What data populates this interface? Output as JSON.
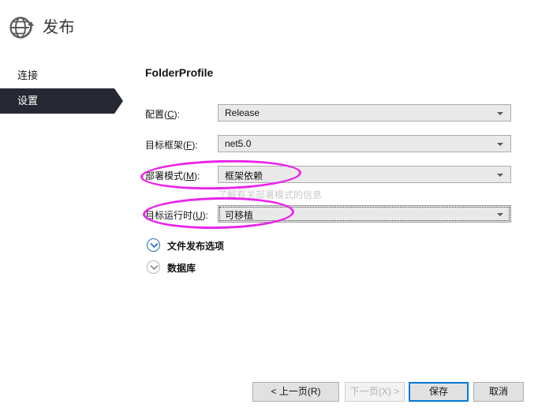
{
  "window": {
    "title": "发布",
    "icon": "globe-publish-icon"
  },
  "sidebar": {
    "items": [
      {
        "label": "连接",
        "selected": false
      },
      {
        "label": "设置",
        "selected": true
      }
    ]
  },
  "main": {
    "profile_title": "FolderProfile",
    "fields": [
      {
        "label_prefix": "配置(",
        "accel": "C",
        "label_suffix": "):",
        "value": "Release",
        "focused": false
      },
      {
        "label_prefix": "目标框架(",
        "accel": "F",
        "label_suffix": "):",
        "value": "net5.0",
        "focused": false
      },
      {
        "label_prefix": "部署模式(",
        "accel": "M",
        "label_suffix": "):",
        "value": "框架依赖",
        "focused": false
      },
      {
        "label_prefix": "目标运行时(",
        "accel": "U",
        "label_suffix": "):",
        "value": "可移植",
        "focused": true
      }
    ],
    "help_link": "了解有关部署模式的信息",
    "expanders": [
      {
        "label": "文件发布选项",
        "chevron": "chevron-down-icon",
        "state": "collapsed",
        "accent": "blue"
      },
      {
        "label": "数据库",
        "chevron": "chevron-down-icon",
        "state": "collapsed",
        "accent": "gray"
      }
    ]
  },
  "footer": {
    "buttons": [
      {
        "label": "< 上一页(R)",
        "accel": "R",
        "state": "enabled"
      },
      {
        "label": "下一页(X) >",
        "accel": "X",
        "state": "disabled"
      },
      {
        "label": "保存",
        "accel": "",
        "state": "default"
      },
      {
        "label": "取消",
        "accel": "",
        "state": "enabled"
      }
    ]
  },
  "annotations": {
    "color": "#ea24ea",
    "shapes": [
      {
        "name": "deploy-mode-highlight",
        "type": "ellipse"
      },
      {
        "name": "target-runtime-highlight",
        "type": "ellipse"
      }
    ]
  },
  "colors": {
    "sidebar_selected_bg": "#262932",
    "primary_button_border": "#0078d7",
    "combo_bg": "#e9e9e9",
    "annotation": "#ea24ea"
  }
}
